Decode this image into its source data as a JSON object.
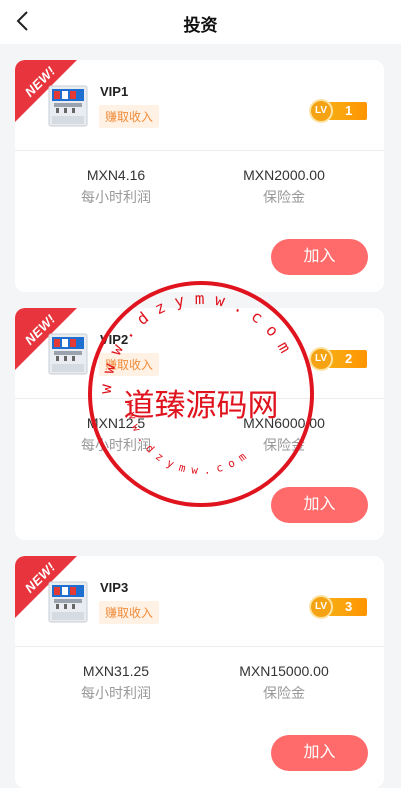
{
  "header": {
    "title": "投资",
    "back_icon": "chevron-left-icon"
  },
  "cards": [
    {
      "ribbon": "NEW!",
      "name": "VIP1",
      "earn": "赚取收入",
      "lv_badge": "LV",
      "level": "1",
      "hourly_value": "MXN4.16",
      "hourly_label": "每小时利润",
      "deposit_value": "MXN2000.00",
      "deposit_label": "保险金",
      "join_label": "加入"
    },
    {
      "ribbon": "NEW!",
      "name": "VIP2",
      "earn": "赚取收入",
      "lv_badge": "LV",
      "level": "2",
      "hourly_value": "MXN12.5",
      "hourly_label": "每小时利润",
      "deposit_value": "MXN6000.00",
      "deposit_label": "保险金",
      "join_label": "加入"
    },
    {
      "ribbon": "NEW!",
      "name": "VIP3",
      "earn": "赚取收入",
      "lv_badge": "LV",
      "level": "3",
      "hourly_value": "MXN31.25",
      "hourly_label": "每小时利润",
      "deposit_value": "MXN15000.00",
      "deposit_label": "保险金",
      "join_label": "加入"
    }
  ],
  "watermark": {
    "center_text": "道臻源码网",
    "ring_top": "w w w . d z y m w . c o m",
    "ring_bottom": "w w w . d z y m w . c o m"
  },
  "colors": {
    "accent": "#ff6b6b",
    "ribbon": "#e8343d",
    "badge_bg": "#fff1e3",
    "badge_text": "#f28c3c",
    "level": "#f5a312",
    "watermark": "#e0141e"
  }
}
